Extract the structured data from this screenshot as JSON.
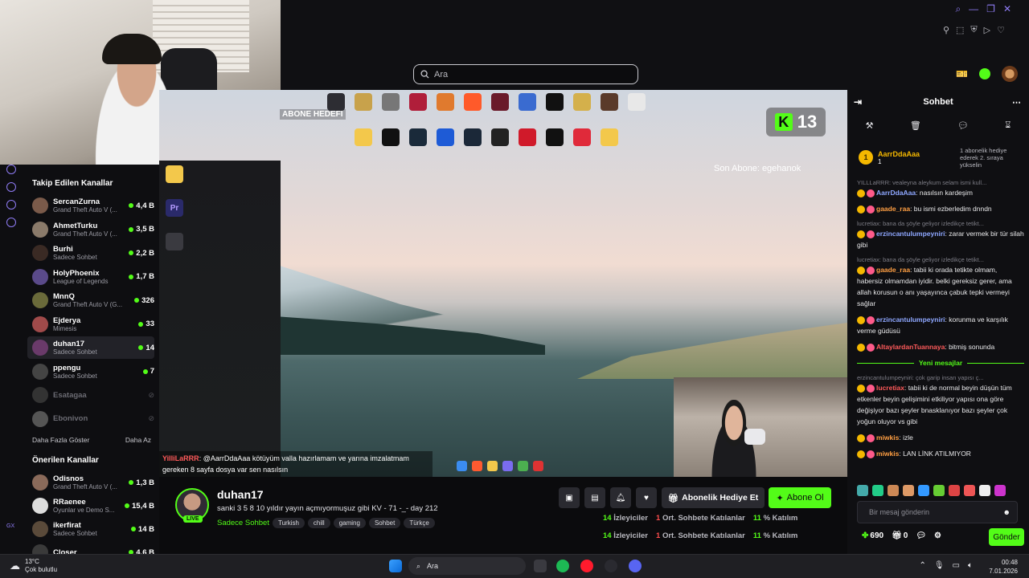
{
  "search": {
    "placeholder": "Ara"
  },
  "sidebar": {
    "followed_title": "Takip Edilen Kanallar",
    "channels": [
      {
        "name": "SercanZurna",
        "game": "Grand Theft Auto V (...",
        "viewers": "4,4 B",
        "live": true
      },
      {
        "name": "AhmetTurku",
        "game": "Grand Theft Auto V (...",
        "viewers": "3,5 B",
        "live": true
      },
      {
        "name": "Burhi",
        "game": "Sadece Sohbet",
        "viewers": "2,2 B",
        "live": true
      },
      {
        "name": "HolyPhoenix",
        "game": "League of Legends",
        "viewers": "1,7 B",
        "live": true
      },
      {
        "name": "MnnQ",
        "game": "Grand Theft Auto V (G...",
        "viewers": "326",
        "live": true
      },
      {
        "name": "Ejderya",
        "game": "Mimesis",
        "viewers": "33",
        "live": true
      },
      {
        "name": "duhan17",
        "game": "Sadece Sohbet",
        "viewers": "14",
        "live": true
      },
      {
        "name": "ppengu",
        "game": "Sadece Sohbet",
        "viewers": "7",
        "live": true
      },
      {
        "name": "Esatagaa",
        "game": "",
        "viewers": "",
        "live": false
      },
      {
        "name": "Ebonivon",
        "game": "",
        "viewers": "",
        "live": false
      }
    ],
    "show_more": "Daha Fazla Göster",
    "show_less": "Daha Az",
    "recommended_title": "Önerilen Kanallar",
    "recommended": [
      {
        "name": "Odisnos",
        "game": "Grand Theft Auto V (...",
        "viewers": "1,3 B"
      },
      {
        "name": "RRaenee",
        "game": "Oyunlar ve Demo S...",
        "viewers": "15,4 B"
      },
      {
        "name": "ikerfirat",
        "game": "Sadece Sohbet",
        "viewers": "14 B"
      },
      {
        "name": "Closer",
        "game": "",
        "viewers": "4,6 B"
      }
    ]
  },
  "video": {
    "goal_text": "ABONE HEDEFİ",
    "kick_count": "13",
    "last_sub": "Son Abone: egehanok",
    "overlay_user": "YilliLaRRR",
    "overlay_msg": ": @AarrDdaAaa kötüyüm valla hazırlamam ve yarına imzalatmam gereken 8 sayfa dosya var sen nasılsın"
  },
  "stream": {
    "name": "duhan17",
    "title": "sanki 3 5 8 10 yıldır yayın açmıyormuşuz gibi KV - 71 -_- day 212",
    "category": "Sadece Sohbet",
    "tags": [
      "Turkish",
      "chill",
      "gaming",
      "Sohbet",
      "Türkçe"
    ],
    "live_label": "LIVE",
    "gift_label": "Abonelik Hediye Et",
    "subscribe_label": "Abone Ol",
    "viewers": "14",
    "viewers_label": "İzleyiciler",
    "chatters": "1",
    "chatters_label": "Ort. Sohbete Katılanlar",
    "participation": "11",
    "participation_label": "% Katılım"
  },
  "chat": {
    "title": "Sohbet",
    "pinned_user": "AarrDdaAaa",
    "pinned_count": "1",
    "pinned_text": "1 abonelik hediye ederek 2. sıraya yükselin",
    "messages": [
      {
        "reply": "YILLLaRRR: vealeyna aleykum selam ismi kull...",
        "user": "AarrDdaAaa",
        "ucls": "u1",
        "text": ": nasılsın kardeşim"
      },
      {
        "reply": "",
        "user": "gaade_raa",
        "ucls": "u2",
        "text": ": bu ismi ezberledim dnndn"
      },
      {
        "reply": "lucretiax: bana da şöyle geliyor izledikçe tetikt...",
        "user": "erzincantulumpeyniri",
        "ucls": "u1",
        "text": ": zarar vermek bir tür silah gibi"
      },
      {
        "reply": "lucretiax: bana da şöyle geliyor izledikçe tetikt...",
        "user": "gaade_raa",
        "ucls": "u2",
        "text": ": tabii ki orada tetikte olmam, habersiz olmamdan iyidir. belki gereksiz gerer, ama allah korusun o anı yaşayınca çabuk tepki vermeyi sağlar"
      },
      {
        "reply": "",
        "user": "erzincantulumpeyniri",
        "ucls": "u1",
        "text": ": korunma ve karşılık verme güdüsü"
      },
      {
        "reply": "",
        "user": "AltaylardanTuannaya",
        "ucls": "u3",
        "text": ": bitmiş sonunda"
      }
    ],
    "new_messages": "Yeni mesajlar",
    "messages2": [
      {
        "reply": "erzincantulumpeyniri: çok garip insan yapısı ç...",
        "user": "lucretiax",
        "ucls": "u3",
        "text": ": tabii ki de normal beyin düşün tüm etkenler beyin gelişimini etkiliyor yapısı ona göre değişiyor bazı şeyler bnasklanıyor bazı şeyler çok yoğun oluyor vs gibi"
      },
      {
        "reply": "",
        "user": "miwkis",
        "ucls": "u2",
        "text": ": izle"
      },
      {
        "reply": "",
        "user": "miwkis",
        "ucls": "u2",
        "text": ": LAN LİNK ATILMIYOR"
      }
    ],
    "input_placeholder": "Bir mesaj gönderin",
    "points": "690",
    "gifts": "0",
    "send_label": "Gönder"
  },
  "taskbar": {
    "temp": "13°C",
    "weather": "Çok bulutlu",
    "search": "Ara",
    "time": "00:48",
    "date": "7.01.2026"
  },
  "colors": {
    "accent": "#53fc18",
    "purple": "#8f7cf5",
    "alert": "#ff4d4d"
  }
}
